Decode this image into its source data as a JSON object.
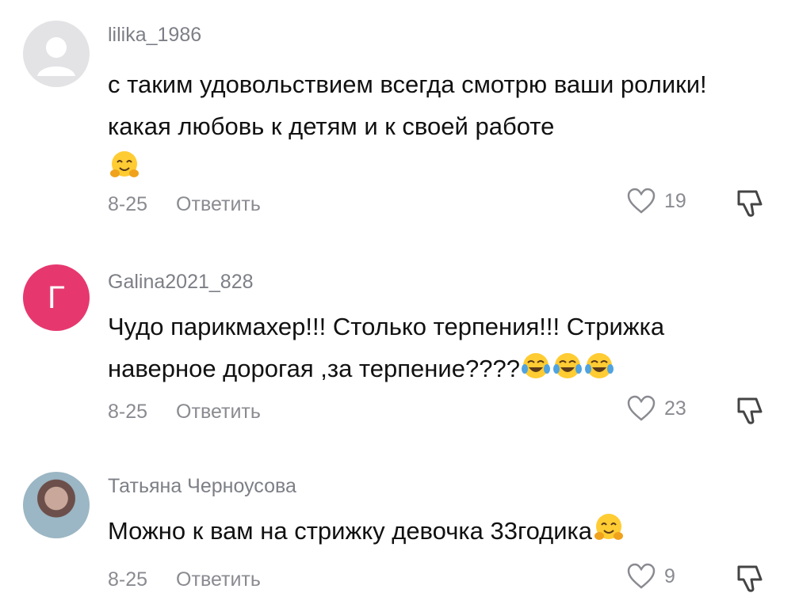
{
  "comments": [
    {
      "username": "lilika_1986",
      "text": "с таким удовольствием всегда смотрю ваши ролики! какая любовь к детям и к своей работе",
      "date": "8-25",
      "reply_label": "Ответить",
      "likes": "19",
      "avatar_type": "default-avatar",
      "emoji": [
        "hugging-face"
      ]
    },
    {
      "username": "Galina2021_828",
      "text": "Чудо парикмахер!!! Столько терпения!!! Стрижка наверное дорогая ,за терпение????",
      "date": "8-25",
      "reply_label": "Ответить",
      "likes": "23",
      "avatar_letter": "Г",
      "emoji": [
        "face-with-tears-of-joy",
        "face-with-tears-of-joy",
        "face-with-tears-of-joy"
      ]
    },
    {
      "username": "Татьяна Черноусова",
      "text": "Можно к вам на стрижку девочка 33годика",
      "date": "8-25",
      "reply_label": "Ответить",
      "likes": "9",
      "avatar_type": "photo-avatar",
      "emoji": [
        "hugging-face"
      ]
    }
  ],
  "colors": {
    "avatar_letter_bg": "#e6386f",
    "muted_text": "#8a8b91",
    "body_text": "#111111"
  }
}
